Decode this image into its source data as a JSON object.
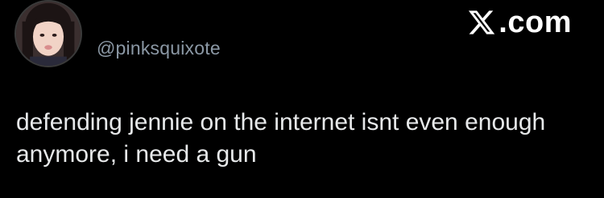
{
  "tweet": {
    "handle": "@pinksquixote",
    "text": "defending jennie on the internet isnt even enough\nanymore, i need a gun"
  },
  "brand": {
    "icon": "x-logo-icon",
    "suffix": ".com"
  },
  "colors": {
    "background": "#000000",
    "text": "#e7e9ea",
    "handle": "#8b98a5",
    "brand": "#ffffff"
  }
}
